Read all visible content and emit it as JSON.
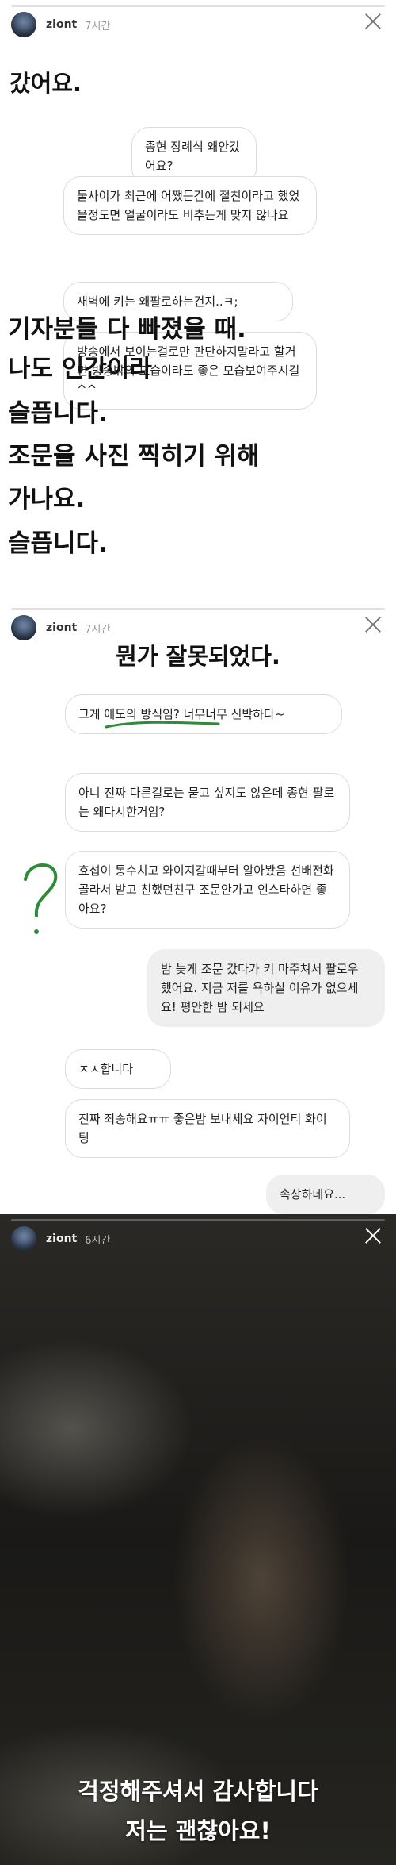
{
  "story1": {
    "username": "ziont",
    "time": "7시간",
    "headline": "갔어요.",
    "bubbles": [
      "종현 장례식 왜안갔어요?",
      "둘사이가 최근에 어쨌든간에 절친이라고 했었을정도면 얼굴이라도 비추는게 맞지 않나요",
      "새벽에 키는 왜팔로하는건지..ㅋ;",
      "방송에서 보이는걸로만 판단하지말라고 할거면 방송밖의 모습이라도 좋은 모습보여주시길^^"
    ],
    "overlay": [
      "기자분들 다 빠졌을 때.",
      "나도 인간이라",
      "슬픕니다.",
      "조문을 사진 찍히기 위해",
      "가나요.",
      "슬픕니다."
    ]
  },
  "story2": {
    "username": "ziont",
    "time": "7시간",
    "headline": "뭔가 잘못되었다.",
    "bubbles": [
      "그게 애도의 방식임? 너무너무 신박하다~",
      "아니 진짜 다른걸로는 묻고 싶지도 않은데 종현 팔로는 왜다시한거임?",
      "효섭이 통수치고 와이지갈때부터 알아봤음 선배전화 골라서 받고 친했던친구 조문안가고 인스타하면 좋아요?",
      "밤 늦게 조문 갔다가 키 마주쳐서 팔로우 했어요. 지금 저를 욕하실 이유가 없으세요! 평안한 밤 되세요",
      "ㅈㅅ합니다",
      "진짜 죄송해요ㅠㅠ 좋은밤 보내세요 자이언티 화이팅",
      "속상하네요..."
    ]
  },
  "story3": {
    "username": "ziont",
    "time": "6시간",
    "caption": [
      "걱정해주셔서 감사합니다",
      "저는 괜찮아요!"
    ]
  },
  "colors": {
    "underline": "#2e8b3a",
    "question_mark": "#2e8b3a"
  }
}
